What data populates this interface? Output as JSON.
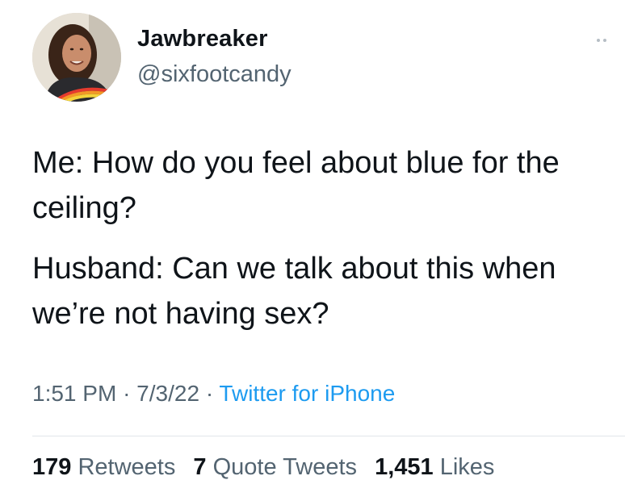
{
  "author": {
    "display_name": "Jawbreaker",
    "handle": "@sixfootcandy"
  },
  "tweet": {
    "lines": [
      "Me: How do you feel about blue for the ceiling?",
      "Husband: Can we talk about this when we’re not having sex?"
    ],
    "time": "1:51 PM",
    "separator": "·",
    "date": "7/3/22",
    "source": "Twitter for iPhone"
  },
  "stats": {
    "retweets_count": "179",
    "retweets_label": "Retweets",
    "quotes_count": "7",
    "quotes_label": "Quote Tweets",
    "likes_count": "1,451",
    "likes_label": "Likes"
  },
  "icons": {
    "more": "more-options-icon"
  },
  "colors": {
    "text": "#0f1419",
    "secondary": "#536471",
    "link": "#1d9bf0",
    "divider": "#e1e6ea"
  }
}
